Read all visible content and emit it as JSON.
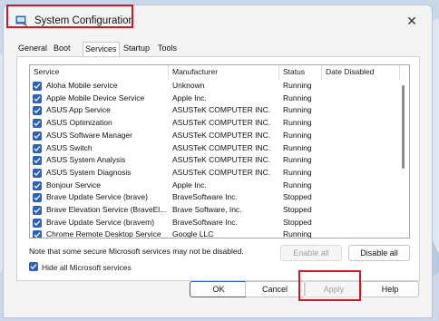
{
  "window": {
    "title": "System Configuration"
  },
  "tabs": [
    "General",
    "Boot",
    "Services",
    "Startup",
    "Tools"
  ],
  "active_tab": "Services",
  "columns": {
    "service": "Service",
    "manufacturer": "Manufacturer",
    "status": "Status",
    "date_disabled": "Date Disabled"
  },
  "services": [
    {
      "name": "Aloha Mobile service",
      "manufacturer": "Unknown",
      "status": "Running",
      "checked": true
    },
    {
      "name": "Apple Mobile Device Service",
      "manufacturer": "Apple Inc.",
      "status": "Running",
      "checked": true
    },
    {
      "name": "ASUS App Service",
      "manufacturer": "ASUSTeK COMPUTER INC.",
      "status": "Running",
      "checked": true
    },
    {
      "name": "ASUS Optimization",
      "manufacturer": "ASUSTeK COMPUTER INC.",
      "status": "Running",
      "checked": true
    },
    {
      "name": "ASUS Software Manager",
      "manufacturer": "ASUSTeK COMPUTER INC.",
      "status": "Running",
      "checked": true
    },
    {
      "name": "ASUS Switch",
      "manufacturer": "ASUSTeK COMPUTER INC.",
      "status": "Running",
      "checked": true
    },
    {
      "name": "ASUS System Analysis",
      "manufacturer": "ASUSTeK COMPUTER INC.",
      "status": "Running",
      "checked": true
    },
    {
      "name": "ASUS System Diagnosis",
      "manufacturer": "ASUSTeK COMPUTER INC.",
      "status": "Running",
      "checked": true
    },
    {
      "name": "Bonjour Service",
      "manufacturer": "Apple Inc.",
      "status": "Running",
      "checked": true
    },
    {
      "name": "Brave Update Service (brave)",
      "manufacturer": "BraveSoftware Inc.",
      "status": "Stopped",
      "checked": true
    },
    {
      "name": "Brave Elevation Service (BraveEl...",
      "manufacturer": "Brave Software, Inc.",
      "status": "Stopped",
      "checked": true
    },
    {
      "name": "Brave Update Service (bravem)",
      "manufacturer": "BraveSoftware Inc.",
      "status": "Stopped",
      "checked": true
    },
    {
      "name": "Chrome Remote Desktop Service",
      "manufacturer": "Google LLC",
      "status": "Running",
      "checked": true
    }
  ],
  "note": "Note that some secure Microsoft services may not be disabled.",
  "buttons": {
    "enable_all": "Enable all",
    "disable_all": "Disable all",
    "ok": "OK",
    "cancel": "Cancel",
    "apply": "Apply",
    "help": "Help"
  },
  "hide_ms": {
    "label": "Hide all Microsoft services",
    "checked": true
  },
  "colors": {
    "accent": "#2a63b8",
    "highlight": "#d21920"
  }
}
